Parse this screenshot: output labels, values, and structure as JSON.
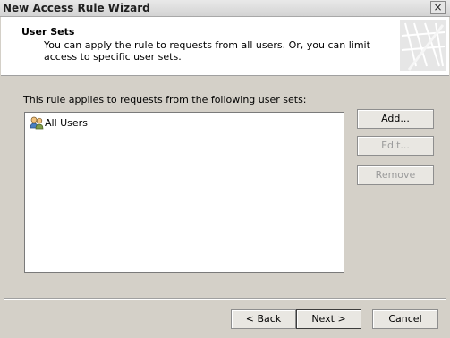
{
  "window": {
    "title": "New Access Rule Wizard",
    "close_label": "×"
  },
  "header": {
    "title": "User Sets",
    "description": "You can apply the rule to requests from all users. Or, you can limit access to specific user sets."
  },
  "main": {
    "intro_text": "This rule applies to requests from the following user sets:",
    "user_sets": [
      {
        "label": "All Users",
        "icon": "users-icon"
      }
    ]
  },
  "side_buttons": {
    "add_label": "Add...",
    "edit_label": "Edit...",
    "remove_label": "Remove"
  },
  "footer": {
    "back_label": "< Back",
    "next_label": "Next >",
    "cancel_label": "Cancel"
  }
}
